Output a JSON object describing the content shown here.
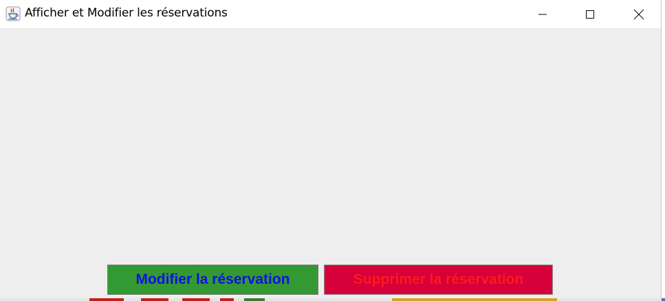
{
  "window": {
    "title": "Afficher et Modifier les réservations"
  },
  "title_bar": {
    "icon": "java-app-icon",
    "minimize_icon": "minimize-icon",
    "maximize_icon": "maximize-icon",
    "close_icon": "close-icon"
  },
  "actions": {
    "modify_label": "Modifier la réservation",
    "delete_label": "Supprimer la réservation"
  },
  "colors": {
    "content_background": "#eeeeee",
    "modify_background": "#339933",
    "modify_text": "#1010e8",
    "delete_background": "#d6003a",
    "delete_text": "#ff1a1a"
  }
}
